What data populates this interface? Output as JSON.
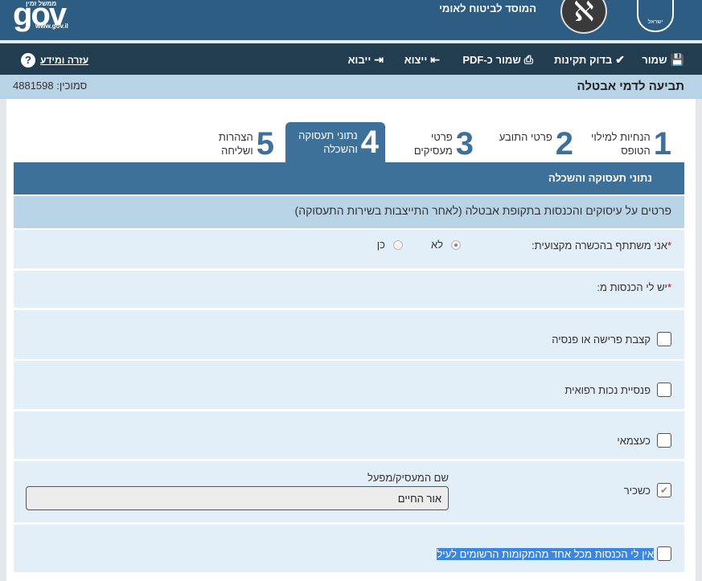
{
  "header": {
    "gov_logo": "gov",
    "gov_tagline": "ממשל זמין",
    "gov_url": "www.gov.il",
    "org_name": "המוסד לביטוח לאומי",
    "emblem_text": "ישראל"
  },
  "toolbar": {
    "save": "שמור",
    "validate": "בדוק תקינות",
    "save_pdf": "שמור כ-PDF",
    "export": "ייצוא",
    "import": "ייבוא",
    "help": "עזרה ומידע",
    "help_icon": "?"
  },
  "page": {
    "title": "תביעה לדמי אבטלה",
    "reference_label": "סמוכין:",
    "reference": "4881598"
  },
  "steps": [
    {
      "num": "1",
      "label": "הנחיות למילוי הטופס"
    },
    {
      "num": "2",
      "label": "פרטי התובע"
    },
    {
      "num": "3",
      "label": "פרטי מעסיקים"
    },
    {
      "num": "4",
      "label": "נתוני תעסוקה והשכלה",
      "active": true
    },
    {
      "num": "5",
      "label": "הצהרות ושליחה"
    }
  ],
  "section": {
    "title": "נתוני תעסוקה והשכלה",
    "description": "פרטים על עיסוקים והכנסות בתקופת אבטלה (לאחר התייצבות בשירות התעסוקה)"
  },
  "training": {
    "label": "אני משתתף בהכשרה מקצועית:",
    "required": "*",
    "options": [
      {
        "label": "לא",
        "selected": true
      },
      {
        "label": "כן",
        "selected": false
      }
    ]
  },
  "income": {
    "label": "יש לי הכנסות מ:",
    "required": "*",
    "items": [
      {
        "label": "קצבת פרישה או פנסיה",
        "checked": false
      },
      {
        "label": "פנסיית נכות רפואית",
        "checked": false
      },
      {
        "label": "כעצמאי",
        "checked": false
      },
      {
        "label": "כשכיר",
        "checked": true
      },
      {
        "label": "אין לי הכנסות מכל אחד מהמקומות הרשומים לעיל",
        "checked": false
      }
    ],
    "employer_label": "שם המעסיק/מפעל",
    "employer_value": "אור החיים"
  }
}
